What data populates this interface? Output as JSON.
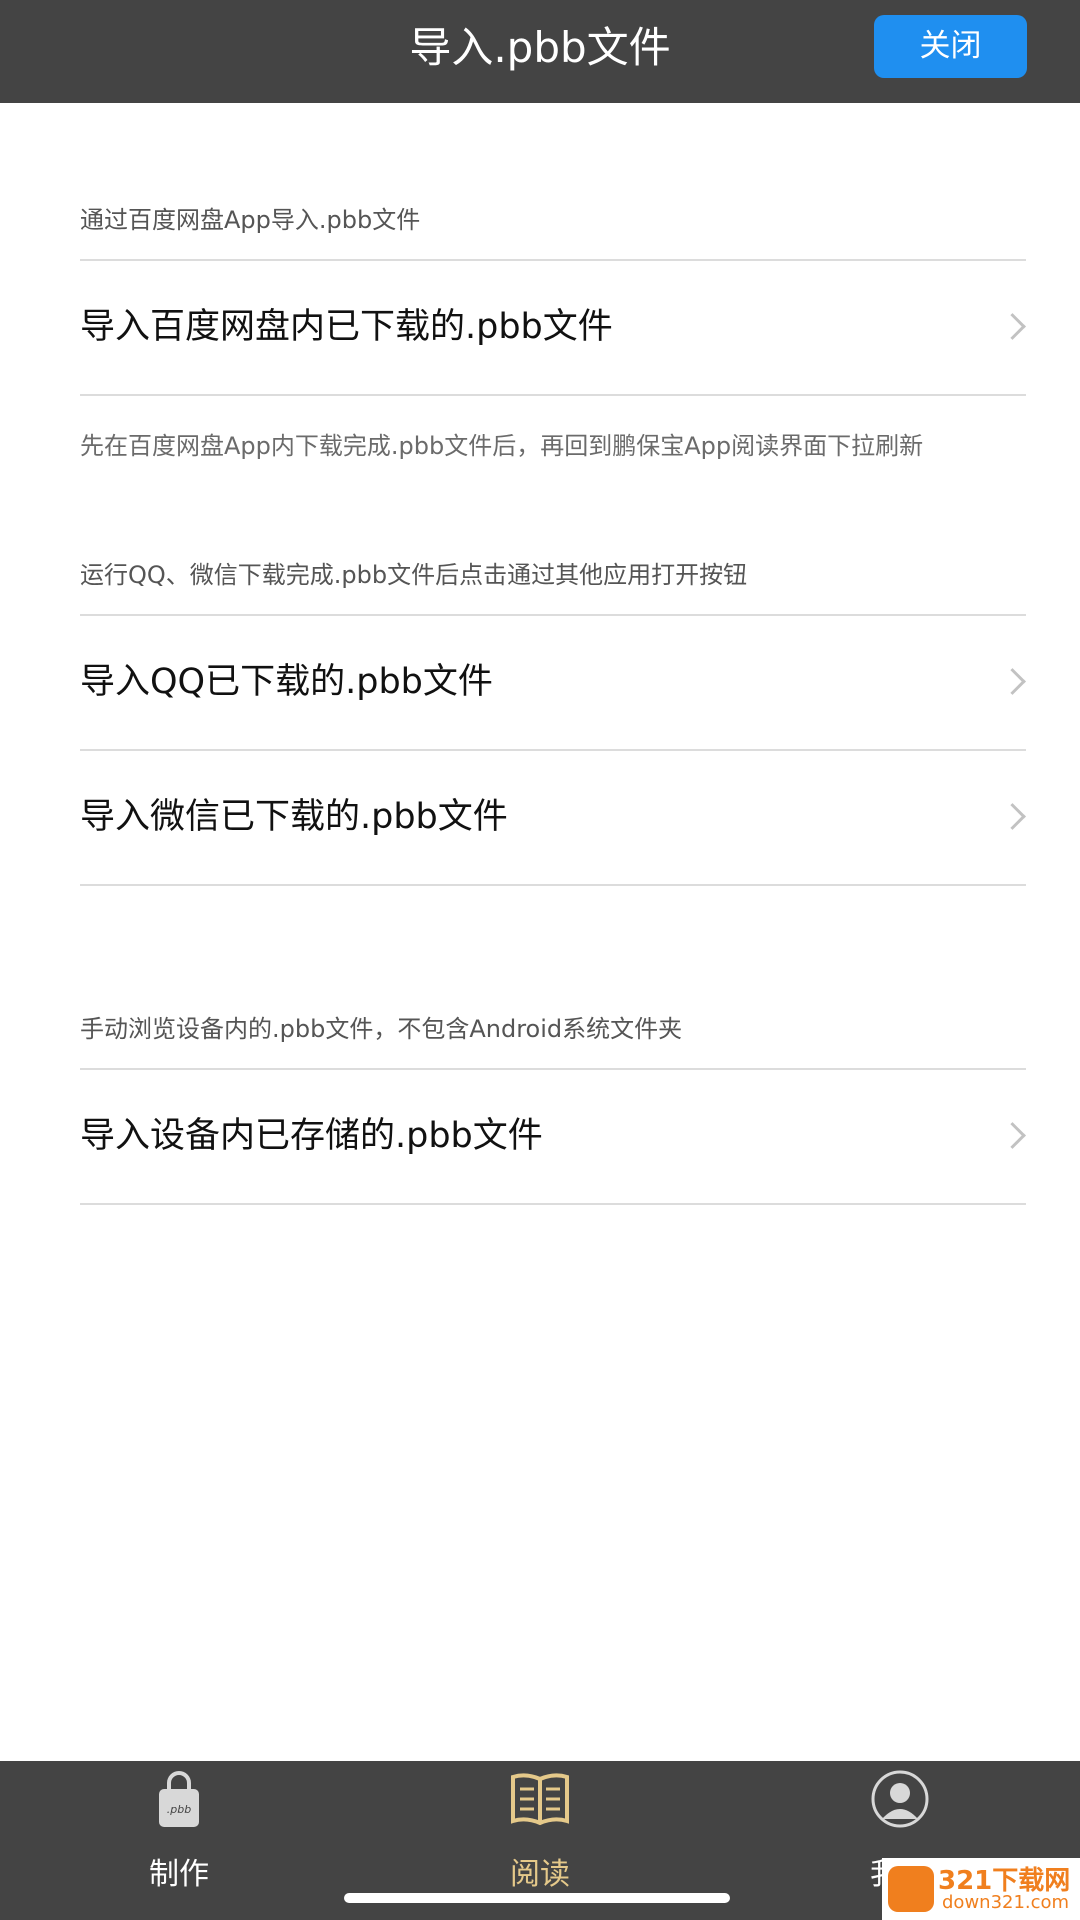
{
  "header": {
    "title": "导入.pbb文件",
    "close_label": "关闭",
    "close_color": "#1f8ff0"
  },
  "sections": [
    {
      "label": "通过百度网盘App导入.pbb文件",
      "rows": [
        {
          "label": "导入百度网盘内已下载的.pbb文件",
          "icon": "chevron-right-icon"
        }
      ],
      "hint": "先在百度网盘App内下载完成.pbb文件后，再回到鹏保宝App阅读界面下拉刷新"
    },
    {
      "label": "运行QQ、微信下载完成.pbb文件后点击通过其他应用打开按钮",
      "rows": [
        {
          "label": "导入QQ已下载的.pbb文件",
          "icon": "chevron-right-icon"
        },
        {
          "label": "导入微信已下载的.pbb文件",
          "icon": "chevron-right-icon"
        }
      ]
    },
    {
      "label": "手动浏览设备内的.pbb文件，不包含Android系统文件夹",
      "rows": [
        {
          "label": "导入设备内已存储的.pbb文件",
          "icon": "chevron-right-icon"
        }
      ]
    }
  ],
  "tabbar": {
    "items": [
      {
        "label": "制作",
        "icon": "lock-file-icon",
        "icon_text": ".pbb",
        "active": false
      },
      {
        "label": "阅读",
        "icon": "book-icon",
        "active": true
      },
      {
        "label": "我的",
        "icon": "user-avatar-icon",
        "active": false
      }
    ],
    "active_color": "#e5c98a"
  },
  "watermark": {
    "main": "321下载网",
    "sub": "down321.com"
  }
}
